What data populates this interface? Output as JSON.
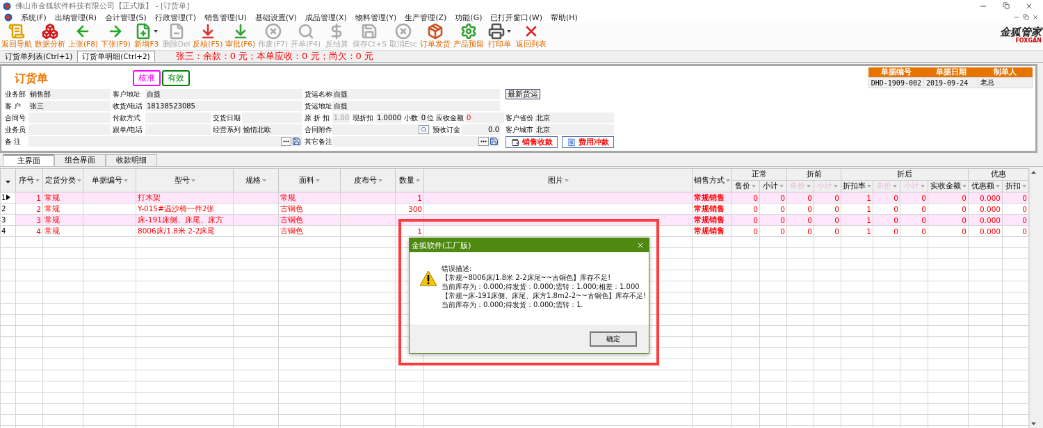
{
  "window": {
    "title": "佛山市金狐软件科技有限公司【正式版】 - [订货单]"
  },
  "menu": [
    "系统(F)",
    "出纳管理(R)",
    "会计管理(S)",
    "行政管理(T)",
    "销售管理(U)",
    "基础设置(V)",
    "成品管理(X)",
    "物料管理(Y)",
    "生产管理(Z)",
    "功能(G)",
    "已打开窗口(W)",
    "帮助(H)"
  ],
  "toolbar": [
    {
      "label": "返回导航",
      "disabled": false,
      "has_menu": false
    },
    {
      "label": "数据分析",
      "disabled": false,
      "has_menu": false
    },
    {
      "label": "上张(F8)",
      "disabled": false,
      "has_menu": false
    },
    {
      "label": "下张(F9)",
      "disabled": false,
      "has_menu": false
    },
    {
      "label": "新增F3",
      "disabled": false,
      "has_menu": true
    },
    {
      "label": "删除Del",
      "disabled": true,
      "has_menu": false
    },
    {
      "label": "反核(F5)",
      "disabled": false,
      "has_menu": false
    },
    {
      "label": "审批(F6)",
      "disabled": false,
      "has_menu": false
    },
    {
      "label": "作废(F7)",
      "disabled": true,
      "has_menu": false
    },
    {
      "label": "开单(F4)",
      "disabled": true,
      "has_menu": false
    },
    {
      "label": "反结算",
      "disabled": true,
      "has_menu": false
    },
    {
      "label": "保存Ct+S",
      "disabled": true,
      "has_menu": false
    },
    {
      "label": "取消Esc",
      "disabled": true,
      "has_menu": false
    },
    {
      "label": "订单发货",
      "disabled": false,
      "has_menu": false
    },
    {
      "label": "产品预留",
      "disabled": false,
      "has_menu": false
    },
    {
      "label": "打印单",
      "disabled": false,
      "has_menu": true
    },
    {
      "label": "返回列表",
      "disabled": false,
      "has_menu": false
    }
  ],
  "logo": {
    "title": "金狐管家",
    "subtitle": "FOXGAN"
  },
  "tabs": [
    {
      "label": "订货单列表(Ctrl+1)",
      "selected": false
    },
    {
      "label": "订货单明细(Ctrl+2)",
      "selected": true
    }
  ],
  "summary": "张三：余款：0 元；本单应收：0 元；尚欠：0 元",
  "form": {
    "title": "订货单",
    "stamps": [
      {
        "label": "核准",
        "color": "#ff00ff"
      },
      {
        "label": "有效",
        "color": "#008000"
      }
    ],
    "doc_table": {
      "columns": [
        "单据编号",
        "单据日期",
        "制单人"
      ],
      "row": [
        "DHD-1909-002",
        "2019-09-24",
        "老总"
      ]
    },
    "left_rows": [
      [
        {
          "label": "业务部",
          "value": "销售部",
          "kind": "text"
        },
        {
          "label": "客户地址",
          "value": "自提",
          "kind": "text"
        }
      ],
      [
        {
          "label": "客 户",
          "value": "张三",
          "kind": "text"
        },
        {
          "label": "收货/电话",
          "value": "18138523085",
          "kind": "text"
        }
      ],
      [
        {
          "label": "合同号",
          "kind": "text"
        },
        {
          "label": "付款方式",
          "kind": "text"
        },
        {
          "label": "交货日期",
          "kind": "text"
        }
      ],
      [
        {
          "label": "业务员",
          "kind": "text"
        },
        {
          "label": "跟单/电话",
          "kind": "text"
        },
        {
          "label": "经营系列",
          "value": "愉情北欧",
          "kind": "text"
        }
      ],
      [
        {
          "label": "备 注",
          "kind": "memo"
        }
      ]
    ],
    "right_rows": [
      [
        {
          "label": "货运名称",
          "value": "自提",
          "kind": "text"
        }
      ],
      [
        {
          "label": "货运地址",
          "value": "自提",
          "kind": "text"
        }
      ],
      [
        {
          "label": "原 折 扣",
          "value": "1.00",
          "kind": "readonly",
          "sub_fields": [
            {
              "label": "现折扣",
              "value": "1.0000",
              "kind": "text"
            },
            {
              "label": "小数",
              "value": "0",
              "kind": "number",
              "suffix": "位"
            }
          ]
        },
        {
          "label": "应收金额",
          "value": "0",
          "kind": "alert"
        }
      ],
      [
        {
          "label": "合同附件",
          "kind": "lookup"
        },
        {
          "label": "预收订金",
          "value": "0.0",
          "kind": "number"
        }
      ],
      [
        {
          "label": "其它备注",
          "kind": "memo"
        }
      ]
    ],
    "latest_button": "最新货运",
    "region_fields": [
      {
        "label": "客户省份",
        "value": "北京"
      },
      {
        "label": "客户城市",
        "value": "北京"
      }
    ],
    "actions": [
      "销售收款",
      "费用冲款"
    ]
  },
  "subtabs": [
    {
      "label": "主界面",
      "selected": true
    },
    {
      "label": "组合界面",
      "selected": false
    },
    {
      "label": "收款明细",
      "selected": false
    }
  ],
  "grid": {
    "columns": [
      {
        "label": "序号"
      },
      {
        "label": "定货分类"
      },
      {
        "label": "单据编号"
      },
      {
        "label": "型号"
      },
      {
        "label": "规格"
      },
      {
        "label": "面料"
      },
      {
        "label": "皮布号"
      },
      {
        "label": "数量"
      },
      {
        "label": "图片"
      },
      {
        "label": "销售方式"
      }
    ],
    "groups": [
      {
        "label": "正常",
        "columns": [
          {
            "label": "售价",
            "disabled": false
          },
          {
            "label": "小计",
            "disabled": false
          }
        ]
      },
      {
        "label": "折前",
        "columns": [
          {
            "label": "单价",
            "disabled": true
          },
          {
            "label": "小计",
            "disabled": true
          }
        ]
      },
      {
        "label": "折后",
        "columns": [
          {
            "label": "折扣率",
            "disabled": false
          },
          {
            "label": "单价",
            "disabled": true
          },
          {
            "label": "小计",
            "disabled": true
          },
          {
            "label": "实收金额",
            "disabled": false
          }
        ]
      },
      {
        "label": "优惠",
        "columns": [
          {
            "label": "优惠额",
            "disabled": false
          },
          {
            "label": "折扣",
            "disabled": false
          }
        ]
      }
    ],
    "rows": [
      {
        "row_number": "1",
        "current": true,
        "cells": [
          "1",
          "常规",
          null,
          "打木架",
          null,
          "常规",
          null,
          "1",
          null,
          "常规销售",
          "0",
          "0",
          "0",
          "0",
          "1",
          "0",
          "0",
          "0",
          "0.000",
          "0"
        ]
      },
      {
        "row_number": "2",
        "current": false,
        "cells": [
          "2",
          "常规",
          null,
          "Y-015#温沙椅一件2张",
          null,
          "古铜色",
          null,
          "300",
          null,
          "常规销售",
          "0",
          "0",
          "0",
          "0",
          "1",
          "0",
          "0",
          "0",
          "0.000",
          "0"
        ]
      },
      {
        "row_number": "3",
        "current": false,
        "cells": [
          "3",
          "常规",
          null,
          "床-191床侧、床尾、床方",
          null,
          "古铜色",
          null,
          null,
          null,
          "常规销售",
          "0",
          "0",
          "0",
          "0",
          "1",
          "0",
          "0",
          "0",
          "0.000",
          "0"
        ]
      },
      {
        "row_number": "4",
        "current": false,
        "cells": [
          "4",
          "常规",
          null,
          "8006床/1.8米 2-2床尾",
          null,
          "古铜色",
          null,
          "1",
          null,
          "常规销售",
          "0",
          "0",
          "0",
          "0",
          "1",
          "0",
          "0",
          "0",
          "0.000",
          "0"
        ]
      }
    ]
  },
  "dialog": {
    "title": "金狐软件(工厂版)",
    "highlighted": true,
    "lines": [
      "错误描述:",
      "【常规~8006床/1.8米 2-2床尾~~古铜色】库存不足!",
      "当前库存为：0.000;待发货：0.000;需转：1.000;相差：1.000",
      "【常规~床-191床侧、床尾、床方1.8m2-2~~古铜色】库存不足!",
      "当前库存为：0.000;待发货：0.000;需转：1."
    ],
    "button": "确定"
  }
}
